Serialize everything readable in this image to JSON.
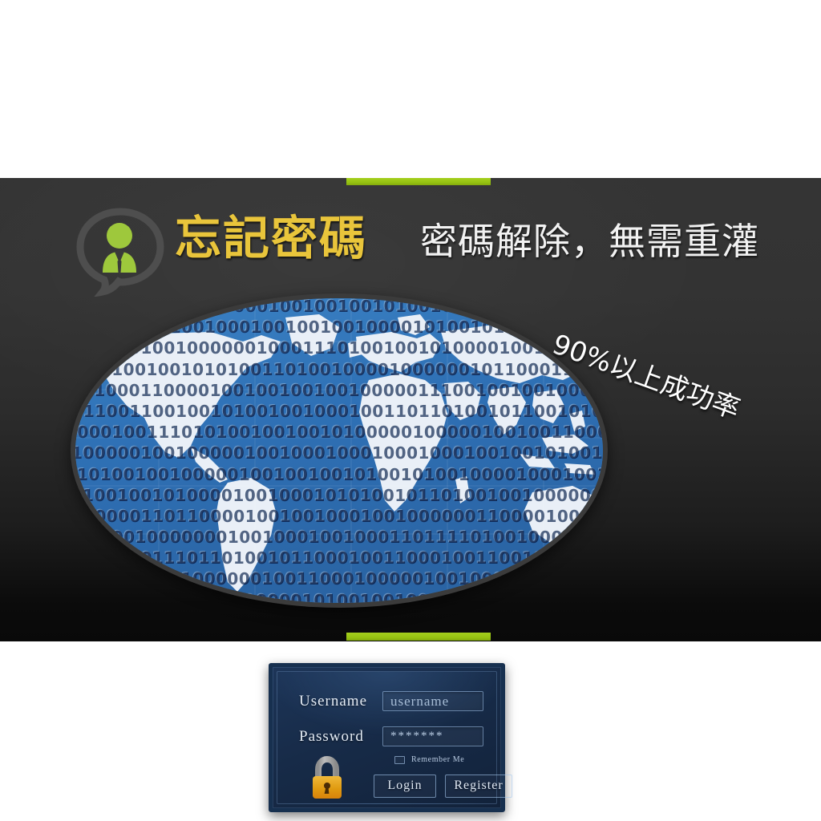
{
  "banner": {
    "accent_color": "#9ec41a",
    "background_dark": "#333333",
    "title": "忘記密碼",
    "title_color": "#e9c53b",
    "subtitle": "密碼解除，無需重灌",
    "subtitle_color": "#f2f2f2",
    "success_rate": "90%以上成功率",
    "person_icon": "person-in-speech-bubble-icon",
    "person_icon_color": "#9ec83c",
    "bubble_color": "#4a4a4a"
  },
  "globe": {
    "ocean_color": "#2f6fb5",
    "land_color": "#e8eef6",
    "border_color": "#3b3b3b",
    "binary_rows": [
      "00010100110001000010010010010",
      "1001000001001000100100100100001010010",
      "1001101001000000100011101001001010000100100",
      "100100100101010011010010000100000010110001100010",
      "1100011000010010010010010000011100100100100",
      "011100110010010100100100010011011010010110010",
      "1000100111010100100100101000001000001001001",
      "1000001001000001001000100010001000100100",
      "101001001000001001001001010010100100001000",
      "10010010100001001000101010010110100100",
      "100000011011000010010010001001000000110",
      "0001001000000010010001001000110111101001",
      "00011001110110100101100010011000100110010101110010",
      "110100000100000010011000100000100100000010010",
      "1000100001001000000101001001000001001",
      "0000100011101001001010010"
    ],
    "binary_digits": "01"
  },
  "login": {
    "username_label": "Username",
    "username_placeholder": "username",
    "password_label": "Password",
    "password_value": "*******",
    "remember_label": "Remember Me",
    "remember_checked": false,
    "login_button": "Login",
    "register_button": "Register",
    "lock_icon": "padlock-icon",
    "lock_body_color": "#e39a12",
    "lock_shackle_color": "#a8a8a8",
    "panel_bg": "#17304f"
  }
}
